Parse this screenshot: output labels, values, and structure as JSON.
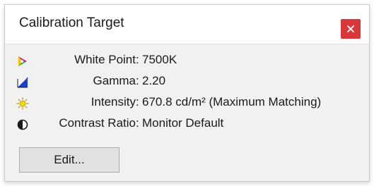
{
  "window": {
    "title": "Calibration Target",
    "close_label": "×"
  },
  "settings": [
    {
      "icon": "color-wheel-icon",
      "label": "White Point",
      "value": "7500K"
    },
    {
      "icon": "gamma-curve-icon",
      "label": "Gamma",
      "value": "2.20"
    },
    {
      "icon": "sun-icon",
      "label": "Intensity",
      "value": "670.8 cd/m² (Maximum Matching)"
    },
    {
      "icon": "contrast-icon",
      "label": "Contrast Ratio",
      "value": "Monitor Default"
    }
  ],
  "edit_button": {
    "label": "Edit..."
  },
  "colors": {
    "close_button": "#d9383b",
    "panel_background": "#f1f1f1",
    "button_background": "#e1e1e1"
  }
}
